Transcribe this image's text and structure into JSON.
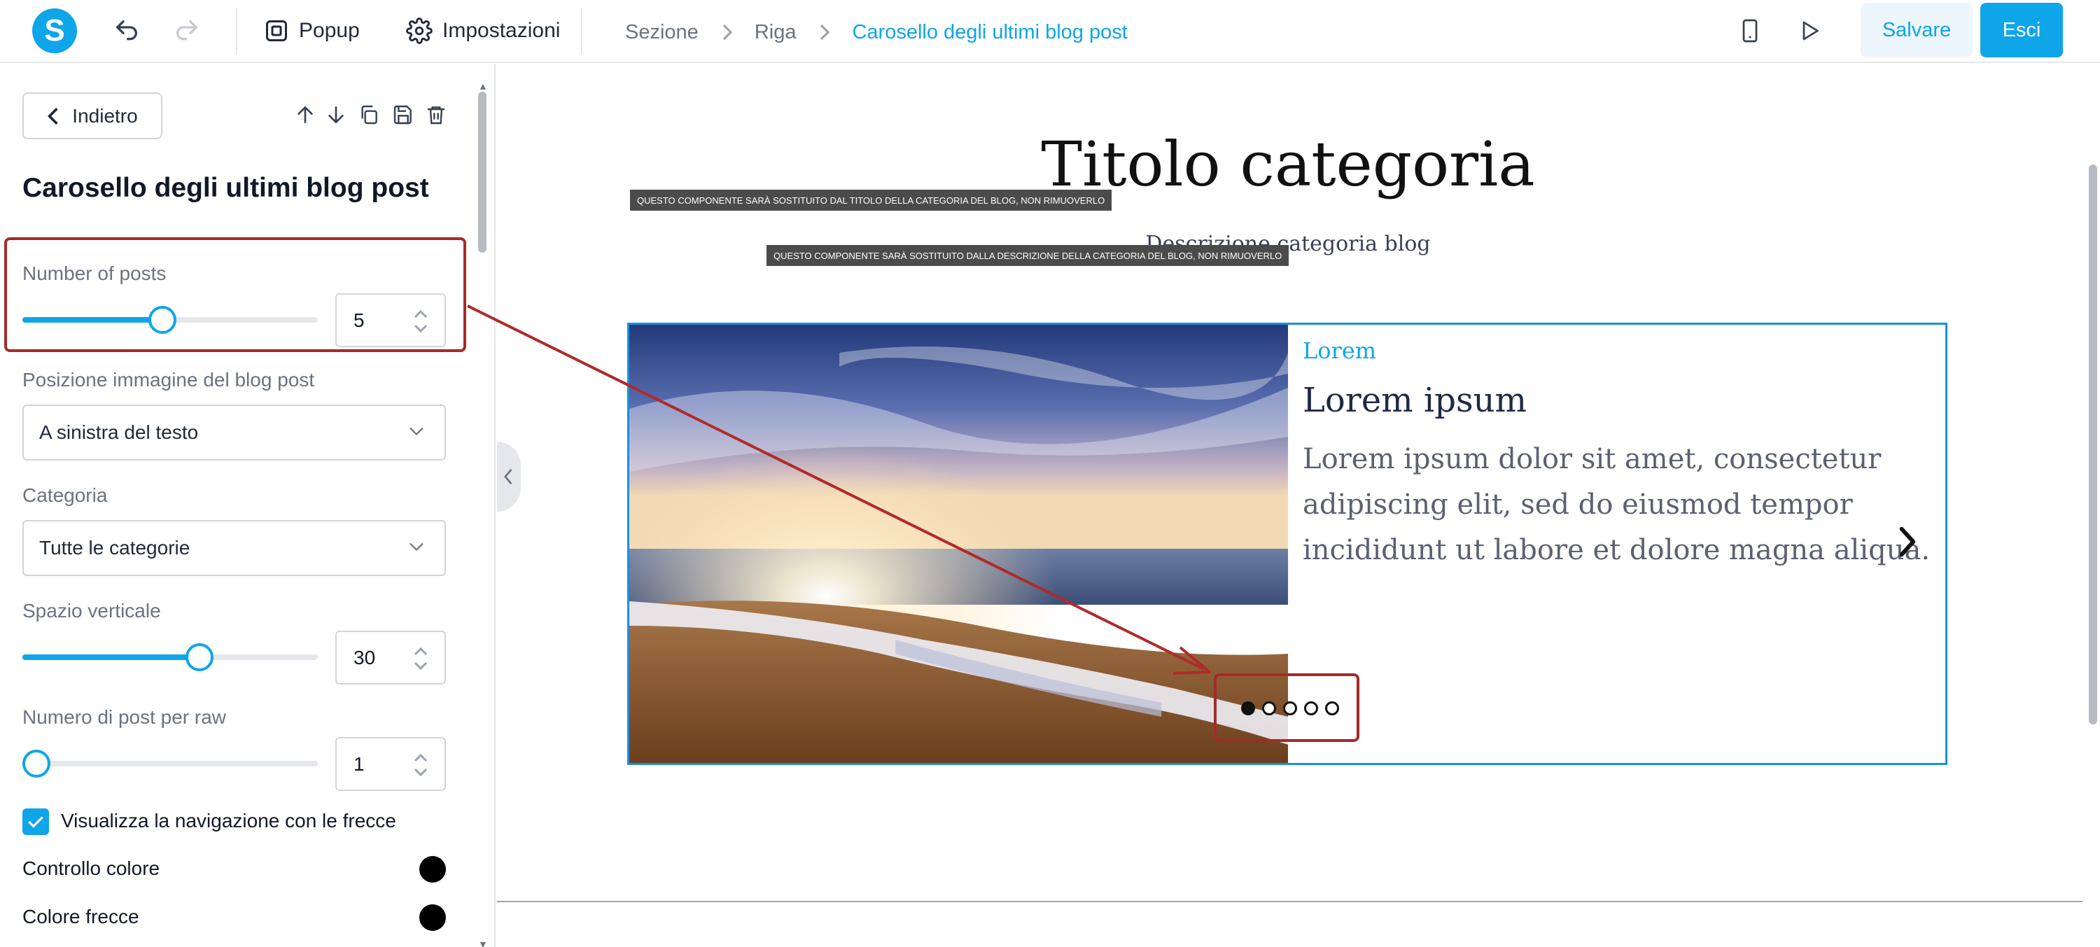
{
  "app": {
    "logo_letter": "S"
  },
  "toolbar": {
    "popup_label": "Popup",
    "settings_label": "Impostazioni",
    "save_label": "Salvare",
    "exit_label": "Esci"
  },
  "breadcrumb": {
    "items": [
      "Sezione",
      "Riga",
      "Carosello degli ultimi blog post"
    ]
  },
  "panel": {
    "back_label": "Indietro",
    "title": "Carosello degli ultimi blog post",
    "number_of_posts": {
      "label": "Number of posts",
      "value": "5",
      "slider_fraction": 0.47
    },
    "image_position": {
      "label": "Posizione immagine del blog post",
      "value": "A sinistra del testo"
    },
    "category": {
      "label": "Categoria",
      "value": "Tutte le categorie"
    },
    "vertical_space": {
      "label": "Spazio verticale",
      "value": "30",
      "slider_fraction": 0.61
    },
    "posts_per_row": {
      "label": "Numero di post per raw",
      "value": "1",
      "slider_fraction": 0.0
    },
    "show_arrows": {
      "label": "Visualizza la navigazione con le frecce",
      "checked": true
    },
    "control_color": {
      "label": "Controllo colore",
      "color": "#000000"
    },
    "arrow_color": {
      "label": "Colore frecce",
      "color": "#000000"
    }
  },
  "canvas": {
    "category_title": "Titolo categoria",
    "category_description": "Descrizione categoria blog",
    "title_notice": "Questo componente sarà sostituito dal titolo della categoria del blog, non rimuoverlo",
    "description_notice": "Questo componente sarà sostituito dalla descrizione della categoria del blog, non rimuoverlo",
    "post": {
      "category": "Lorem",
      "title": "Lorem ipsum",
      "text": "Lorem ipsum dolor sit amet, consectetur adipiscing elit, sed do eiusmod tempor incididunt ut labore et dolore magna aliqua."
    },
    "dots_count": 5,
    "active_dot": 1
  },
  "colors": {
    "accent": "#0ea5e9",
    "annotation": "#a52a2a"
  }
}
